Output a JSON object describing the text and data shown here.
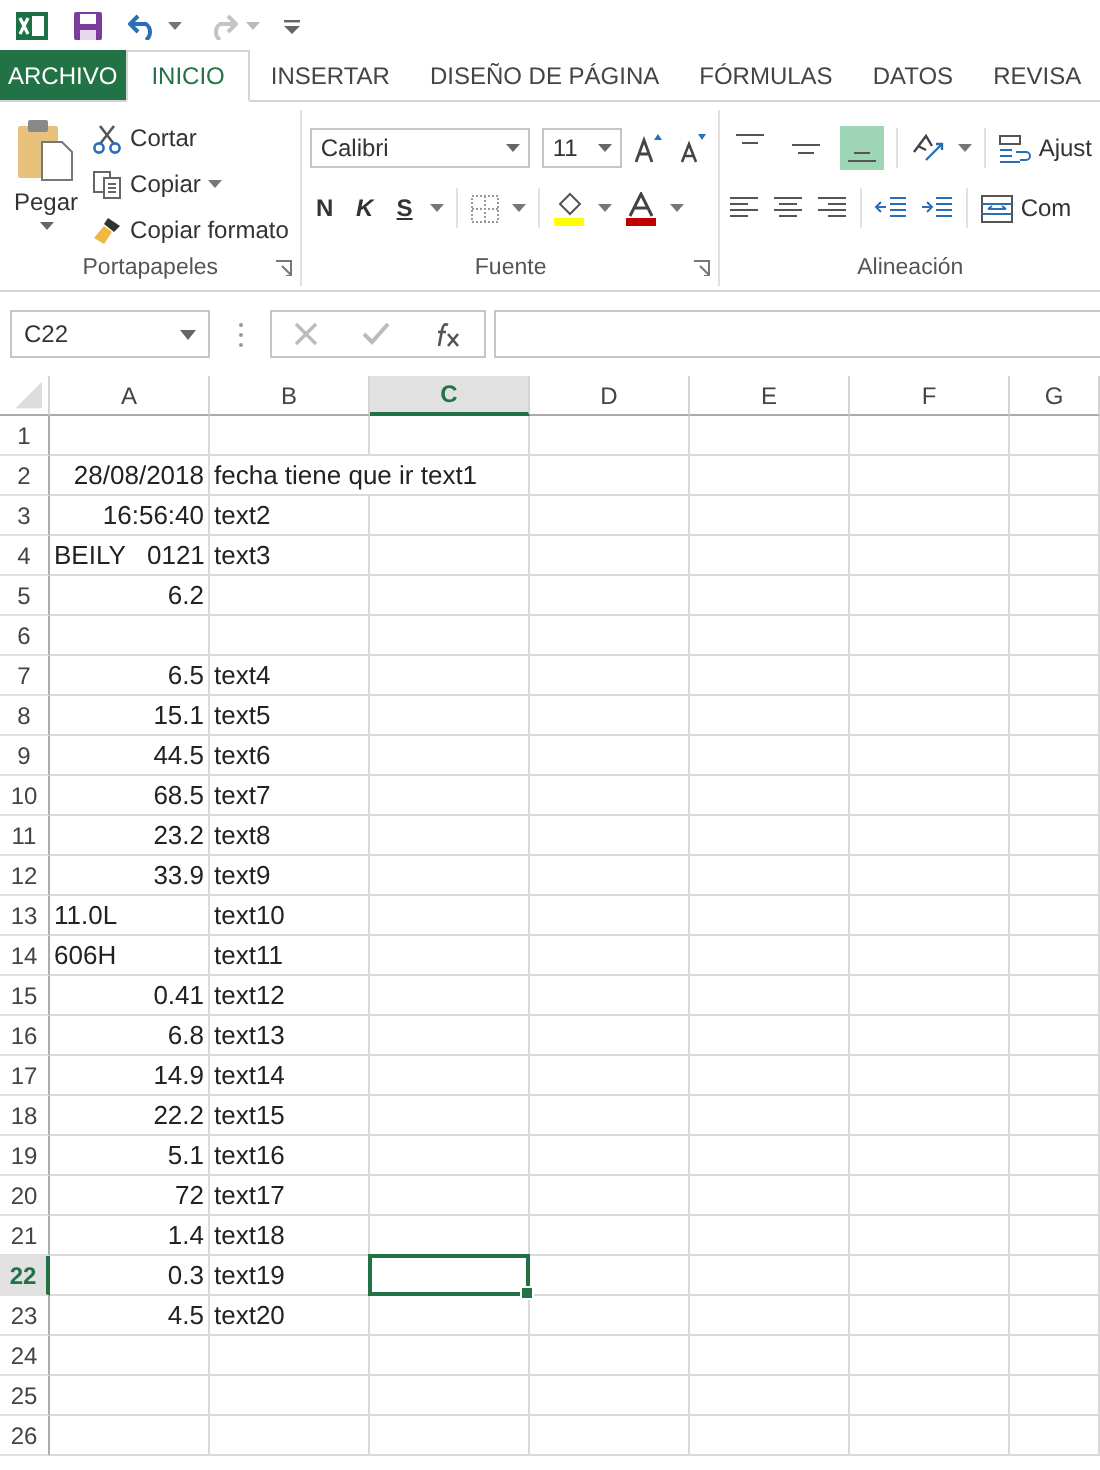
{
  "quick_access": [
    {
      "kind": "app-logo"
    },
    {
      "kind": "save"
    },
    {
      "kind": "customize"
    }
  ],
  "history": [
    {
      "kind": "undo",
      "disabled": false
    },
    {
      "kind": "redo",
      "disabled": true
    }
  ],
  "tabs": [
    {
      "label": "ARCHIVO",
      "kind": "file",
      "selected": false
    },
    {
      "label": "INICIO",
      "kind": "tab",
      "selected": true
    },
    {
      "label": "INSERTAR",
      "kind": "tab",
      "selected": false
    },
    {
      "label": "DISEÑO DE PÁGINA",
      "kind": "tab",
      "selected": false
    },
    {
      "label": "FÓRMULAS",
      "kind": "tab",
      "selected": false
    },
    {
      "label": "DATOS",
      "kind": "tab",
      "selected": false
    },
    {
      "label": "REVISA",
      "kind": "tab",
      "selected": false
    }
  ],
  "ribbon": {
    "clipboard": {
      "label": "Portapapeles",
      "paste": "Pegar",
      "commands": [
        {
          "kind": "cut",
          "label": "Cortar"
        },
        {
          "kind": "copy",
          "label": "Copiar"
        },
        {
          "kind": "format-painter",
          "label": "Copiar formato"
        }
      ]
    },
    "font": {
      "label": "Fuente",
      "font_name": "Calibri",
      "font_size": "11",
      "styles": [
        {
          "kind": "bold",
          "label": "N"
        },
        {
          "kind": "italic",
          "label": "K"
        },
        {
          "kind": "underline",
          "label": "S"
        }
      ]
    },
    "alignment": {
      "label": "Alineación",
      "vertical": [
        {
          "kind": "top",
          "selected": false
        },
        {
          "kind": "middle",
          "selected": false
        },
        {
          "kind": "bottom",
          "selected": true
        }
      ],
      "wrap": "Ajust",
      "merge": "Com"
    }
  },
  "formula_bar": {
    "name_box": "C22",
    "buttons": [
      {
        "kind": "cancel",
        "disabled": true
      },
      {
        "kind": "enter",
        "disabled": true
      },
      {
        "kind": "function",
        "disabled": false
      }
    ]
  },
  "sheet": {
    "columns": [
      {
        "label": "A",
        "selected": false
      },
      {
        "label": "B",
        "selected": false
      },
      {
        "label": "C",
        "selected": true
      },
      {
        "label": "D",
        "selected": false
      },
      {
        "label": "E",
        "selected": false
      },
      {
        "label": "F",
        "selected": false
      },
      {
        "label": "G",
        "selected": false
      }
    ],
    "rows": [
      {
        "label": "1",
        "selected": false,
        "cells": []
      },
      {
        "label": "2",
        "selected": false,
        "cells": [
          {
            "value": "28/08/2018",
            "kind": "number"
          },
          {
            "value": "fecha tiene que ir text1",
            "kind": "text"
          }
        ]
      },
      {
        "label": "3",
        "selected": false,
        "cells": [
          {
            "value": "16:56:40",
            "kind": "number"
          },
          {
            "value": "text2",
            "kind": "text"
          }
        ]
      },
      {
        "label": "4",
        "selected": false,
        "cells": [
          {
            "value": "BEILY   0121",
            "kind": "text"
          },
          {
            "value": "text3",
            "kind": "text"
          }
        ]
      },
      {
        "label": "5",
        "selected": false,
        "cells": [
          {
            "value": "6.2",
            "kind": "number"
          }
        ]
      },
      {
        "label": "6",
        "selected": false,
        "cells": []
      },
      {
        "label": "7",
        "selected": false,
        "cells": [
          {
            "value": "6.5",
            "kind": "number"
          },
          {
            "value": "text4",
            "kind": "text"
          }
        ]
      },
      {
        "label": "8",
        "selected": false,
        "cells": [
          {
            "value": "15.1",
            "kind": "number"
          },
          {
            "value": "text5",
            "kind": "text"
          }
        ]
      },
      {
        "label": "9",
        "selected": false,
        "cells": [
          {
            "value": "44.5",
            "kind": "number"
          },
          {
            "value": "text6",
            "kind": "text"
          }
        ]
      },
      {
        "label": "10",
        "selected": false,
        "cells": [
          {
            "value": "68.5",
            "kind": "number"
          },
          {
            "value": "text7",
            "kind": "text"
          }
        ]
      },
      {
        "label": "11",
        "selected": false,
        "cells": [
          {
            "value": "23.2",
            "kind": "number"
          },
          {
            "value": "text8",
            "kind": "text"
          }
        ]
      },
      {
        "label": "12",
        "selected": false,
        "cells": [
          {
            "value": "33.9",
            "kind": "number"
          },
          {
            "value": "text9",
            "kind": "text"
          }
        ]
      },
      {
        "label": "13",
        "selected": false,
        "cells": [
          {
            "value": "11.0L",
            "kind": "text"
          },
          {
            "value": "text10",
            "kind": "text"
          }
        ]
      },
      {
        "label": "14",
        "selected": false,
        "cells": [
          {
            "value": "606H",
            "kind": "text"
          },
          {
            "value": "text11",
            "kind": "text"
          }
        ]
      },
      {
        "label": "15",
        "selected": false,
        "cells": [
          {
            "value": "0.41",
            "kind": "number"
          },
          {
            "value": "text12",
            "kind": "text"
          }
        ]
      },
      {
        "label": "16",
        "selected": false,
        "cells": [
          {
            "value": "6.8",
            "kind": "number"
          },
          {
            "value": "text13",
            "kind": "text"
          }
        ]
      },
      {
        "label": "17",
        "selected": false,
        "cells": [
          {
            "value": "14.9",
            "kind": "number"
          },
          {
            "value": "text14",
            "kind": "text"
          }
        ]
      },
      {
        "label": "18",
        "selected": false,
        "cells": [
          {
            "value": "22.2",
            "kind": "number"
          },
          {
            "value": "text15",
            "kind": "text"
          }
        ]
      },
      {
        "label": "19",
        "selected": false,
        "cells": [
          {
            "value": "5.1",
            "kind": "number"
          },
          {
            "value": "text16",
            "kind": "text"
          }
        ]
      },
      {
        "label": "20",
        "selected": false,
        "cells": [
          {
            "value": "72",
            "kind": "number"
          },
          {
            "value": "text17",
            "kind": "text"
          }
        ]
      },
      {
        "label": "21",
        "selected": false,
        "cells": [
          {
            "value": "1.4",
            "kind": "number"
          },
          {
            "value": "text18",
            "kind": "text"
          }
        ]
      },
      {
        "label": "22",
        "selected": true,
        "cells": [
          {
            "value": "0.3",
            "kind": "number"
          },
          {
            "value": "text19",
            "kind": "text"
          }
        ]
      },
      {
        "label": "23",
        "selected": false,
        "cells": [
          {
            "value": "4.5",
            "kind": "number"
          },
          {
            "value": "text20",
            "kind": "text"
          }
        ]
      },
      {
        "label": "24",
        "selected": false,
        "cells": []
      },
      {
        "label": "25",
        "selected": false,
        "cells": []
      },
      {
        "label": "26",
        "selected": false,
        "cells": []
      }
    ]
  }
}
